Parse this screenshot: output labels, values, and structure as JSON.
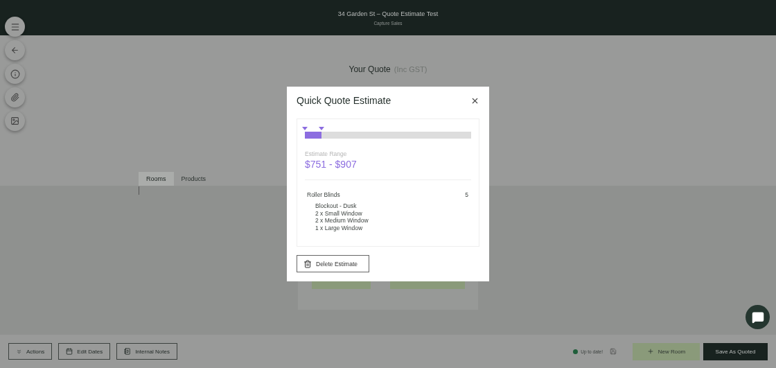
{
  "header": {
    "title": "34 Garden St – Quote Estimate Test",
    "subtitle": "Capture Sales"
  },
  "quote": {
    "title": "Your Quote",
    "note": "(Inc GST)"
  },
  "tabs": [
    {
      "label": "Rooms",
      "selected": true
    },
    {
      "label": "Products",
      "selected": false
    }
  ],
  "modal": {
    "title": "Quick Quote Estimate",
    "range_bar": {
      "level": 0.1
    },
    "range_label": "Estimate Range",
    "range": "$751 - $907",
    "items": [
      {
        "name": "Roller Blinds",
        "count": "5",
        "details": [
          "Blockout - Dusk",
          "2 x Small Window",
          "2 x Medium Window",
          "1 x Large Window"
        ]
      }
    ],
    "delete_button": "Delete Estimate"
  },
  "footer": {
    "buttons": [
      {
        "kind": "actions",
        "label": "Actions"
      },
      {
        "kind": "dates",
        "label": "Edit Dates"
      },
      {
        "kind": "notes",
        "label": "Internal Notes"
      }
    ],
    "status": {
      "text": "Up to date!",
      "color": "#1f5e3a"
    },
    "new_room": "New Room",
    "save": "Save As Quoted"
  }
}
